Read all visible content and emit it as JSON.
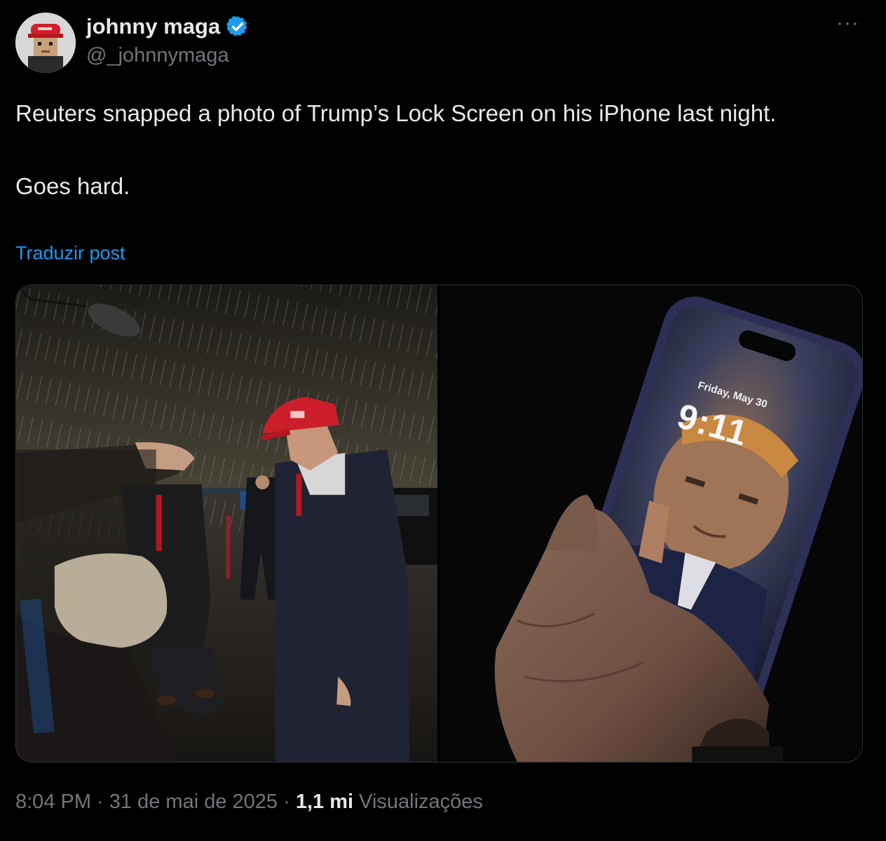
{
  "author": {
    "display_name": "johnny maga",
    "handle": "@_johnnymaga",
    "verified": true
  },
  "tweet": {
    "text_line1": "Reuters snapped a photo of Trump’s Lock Screen on his iPhone last night.",
    "text_line2": "Goes hard.",
    "translate_label": "Traduzir post"
  },
  "media": {
    "lock_screen_date": "Friday, May 30",
    "lock_screen_time": "9:11"
  },
  "meta": {
    "time": "8:04 PM",
    "separator": "·",
    "date": "31 de mai de 2025",
    "views_count": "1,1 mi",
    "views_label": "Visualizações"
  },
  "colors": {
    "background": "#000000",
    "text": "#e7e9ea",
    "muted": "#71767b",
    "link": "#1d9bf0",
    "verified": "#1d9bf0"
  },
  "icons": {
    "verified": "verified-badge-icon",
    "more": "more-options-icon"
  }
}
